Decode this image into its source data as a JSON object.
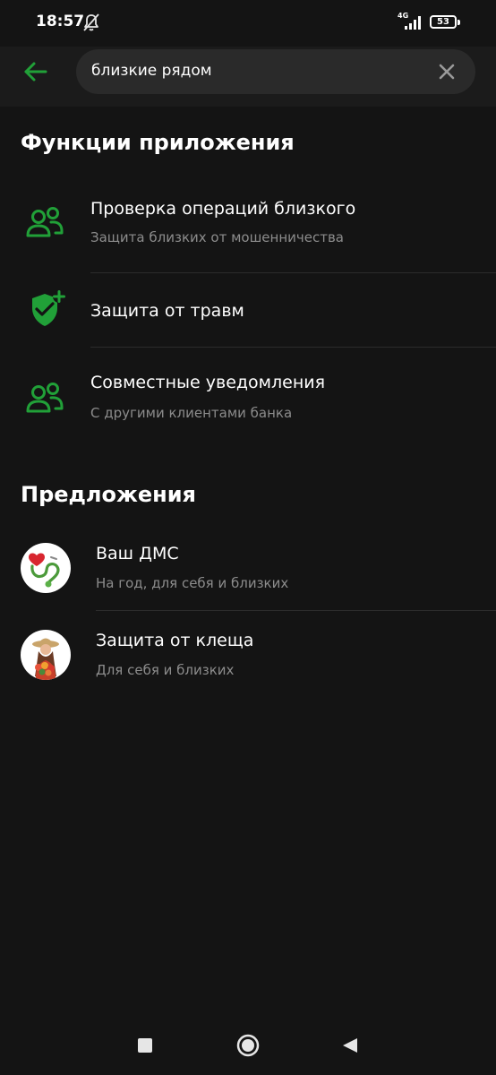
{
  "status_bar": {
    "time": "18:57",
    "network": "4G",
    "battery": "53"
  },
  "search": {
    "query": "близкие рядом"
  },
  "sections": {
    "features": {
      "title": "Функции приложения",
      "items": [
        {
          "title": "Проверка операций близкого",
          "subtitle": "Защита близких от мошенничества",
          "icon": "people-icon"
        },
        {
          "title": "Защита от травм",
          "subtitle": "",
          "icon": "shield-plus-icon"
        },
        {
          "title": "Совместные уведомления",
          "subtitle": "С другими клиентами банка",
          "icon": "people-icon"
        }
      ]
    },
    "offers": {
      "title": "Предложения",
      "items": [
        {
          "title": "Ваш ДМС",
          "subtitle": "На год, для себя и близких",
          "icon": "stethoscope-heart-avatar"
        },
        {
          "title": "Защита от клеща",
          "subtitle": "Для себя и близких",
          "icon": "woman-with-flowers-avatar"
        }
      ]
    }
  },
  "colors": {
    "background": "#141414",
    "header": "#1b1b1b",
    "search_field": "#2a2a2a",
    "accent_green": "#21a038",
    "secondary_text": "#8c8c8c"
  }
}
